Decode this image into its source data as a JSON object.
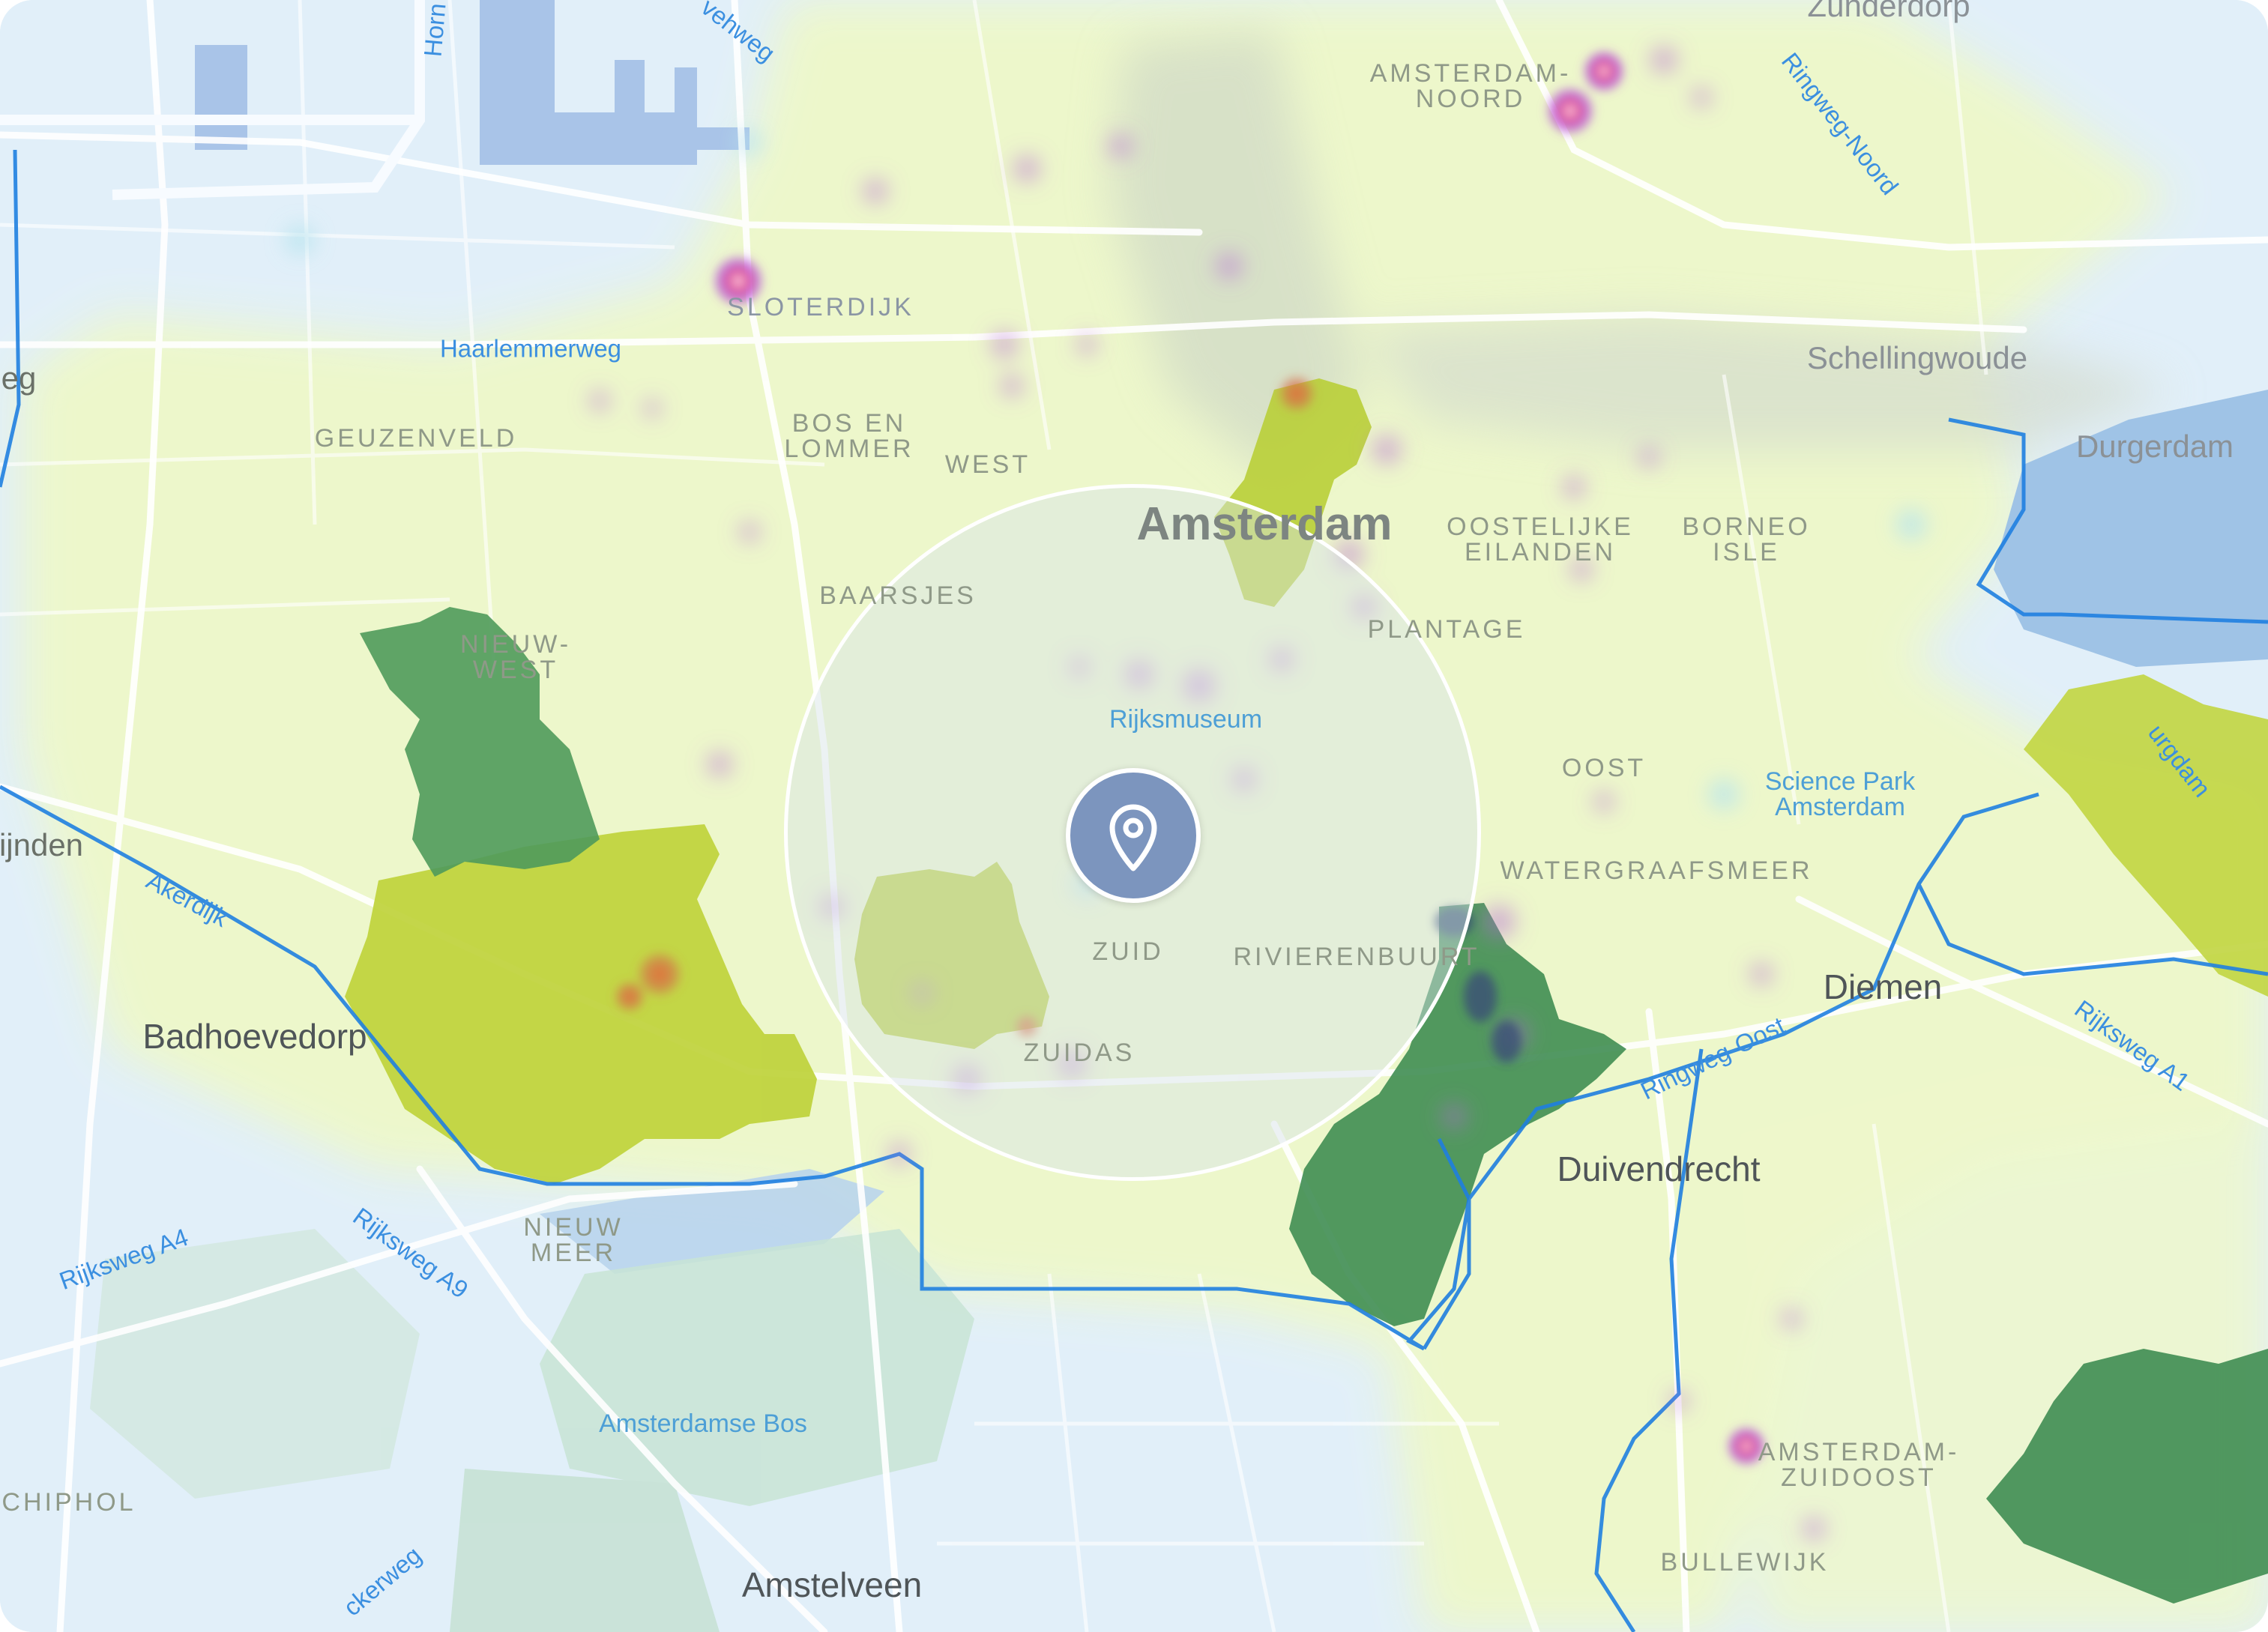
{
  "map": {
    "labels": {
      "amsterdam": "Amsterdam",
      "amsterdam_noord": "AMSTERDAM-\nNOORD",
      "zunderdorp": "Zunderdorp",
      "schellingwoude": "Schellingwoude",
      "durgerdam": "Durgerdam",
      "sloterdijk": "SLOTERDIJK",
      "geuzenveld": "GEUZENVELD",
      "bos_en_lommer": "BOS EN\nLOMMER",
      "west": "WEST",
      "baarsjes": "BAARSJES",
      "oostelijke_eilanden": "OOSTELIJKE\nEILANDEN",
      "borneo_isle": "BORNEO\nISLE",
      "plantage": "PLANTAGE",
      "nieuw_west": "NIEUW-\nWEST",
      "oost": "OOST",
      "watergraafsmeer": "WATERGRAAFSMEER",
      "zuid": "ZUID",
      "rivierenbuurt": "RIVIERENBUURT",
      "zuidas": "ZUIDAS",
      "badhoevedorp": "Badhoevedorp",
      "diemen": "Diemen",
      "duivendrecht": "Duivendrecht",
      "nieuw_meer": "NIEUW\nMEER",
      "schiphol": "CHIPHOL",
      "amstelveen": "Amstelveen",
      "amsterdam_zuidoost": "AMSTERDAM-\nZUIDOOST",
      "bullewijk": "BULLEWIJK",
      "ijnden": "ijnden",
      "eg": "eg"
    },
    "roads": {
      "haarlemmerweg": "Haarlemmerweg",
      "ringweg_noord": "Ringweg-Noord",
      "ringweg_oost": "Ringweg-Oost",
      "rijksweg_a1": "Rijksweg A1",
      "rijksweg_a4": "Rijksweg A4",
      "rijksweg_a9": "Rijksweg A9",
      "akerdijk": "Akerdijk",
      "hornweg": "Horn",
      "veheweg": "vehweg",
      "ckerweg": "ckerweg",
      "durgerdam_road": "urgdam"
    },
    "pois": {
      "rijksmuseum": "Rijksmuseum",
      "science_park": "Science Park\nAmsterdam",
      "amsterdamse_bos": "Amsterdamse Bos"
    },
    "location_pin_icon": "map-pin-icon",
    "colors": {
      "water": "#9fc3e6",
      "land": "#e3f1fb",
      "heat_light": "#eef9c6",
      "heat_yellow": "#bfd33f",
      "heat_green": "#3f8f55",
      "hotspot": "#c05ed0",
      "boundary": "#1f7fe0",
      "pin": "#7c95be"
    }
  }
}
